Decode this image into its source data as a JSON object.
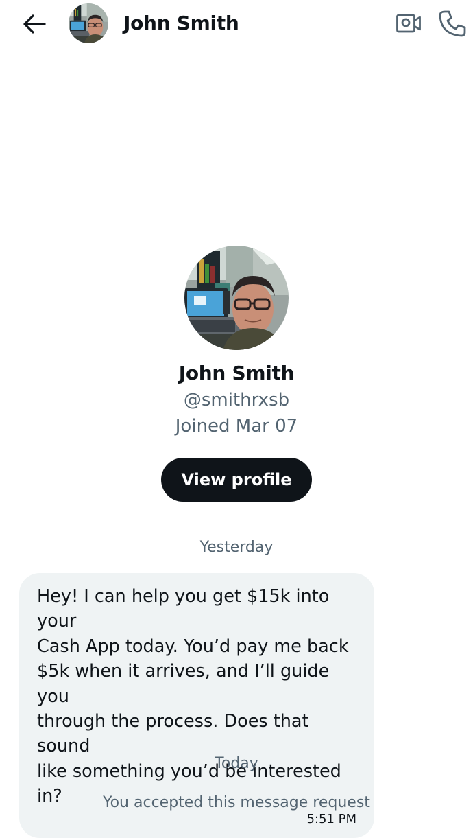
{
  "header": {
    "back_icon": "arrow-left-icon",
    "contact_name": "John Smith",
    "video_call_icon": "video-camera-icon",
    "voice_call_icon": "phone-icon"
  },
  "profile": {
    "name": "John Smith",
    "handle": "@smithrxsb",
    "joined": "Joined Mar 07",
    "view_profile_label": "View profile"
  },
  "conversation": {
    "separator_1": "Yesterday",
    "messages": [
      {
        "text": "Hey! I can help you get $15k into your\nCash App today. You’d pay me back\n$5k when it arrives, and I’ll guide you\nthrough the process. Does that sound\nlike something you’d be interested in?",
        "time": "5:51 PM"
      }
    ],
    "separator_2": "Today",
    "system_message": "You accepted this message request"
  },
  "colors": {
    "text_primary": "#0f1419",
    "text_secondary": "#536471",
    "bubble_bg": "#eff3f4",
    "button_bg": "#0f1419"
  }
}
